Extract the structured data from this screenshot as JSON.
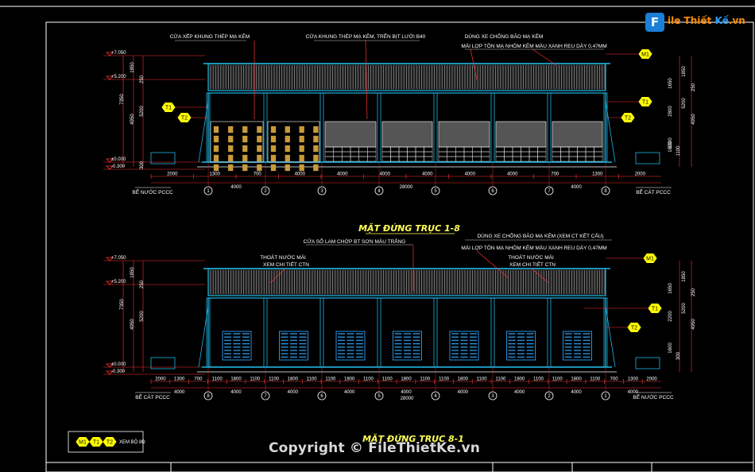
{
  "elev_top": {
    "title": "MẶT ĐỨNG TRỤC 1-8",
    "notes": [
      "CỬA XẾP KHUNG THÉP MẠ KẼM",
      "CỬA KHUNG THÉP MẠ KẼM, TRÊN BỊT LƯỚI B40",
      "DÙNG XE CHỐNG BÃO MẠ KẼM",
      "MÁI LỢP TÔN MẠ NHÔM KẼM MÀU XANH REU DÀY 0,47MM"
    ],
    "levels": [
      "+7.050",
      "+5.200",
      "±0.000",
      "-0.300"
    ],
    "tags": [
      "T1",
      "T2",
      "M1",
      "T1",
      "T2"
    ],
    "dims_row1": [
      "2000",
      "1300",
      "700",
      "4000",
      "4000",
      "4000",
      "4000",
      "4000",
      "4000",
      "700",
      "1300",
      "2000"
    ],
    "dims_row2": [
      "4000",
      "28000",
      "4000"
    ],
    "axes": [
      "1",
      "2",
      "3",
      "4",
      "5",
      "6",
      "7",
      "8"
    ],
    "labels": [
      "BỂ NƯỚC PCCC",
      "BỂ CÁT PCCC"
    ],
    "vert_dims": [
      "1850",
      "250",
      "5200",
      "4950",
      "7350",
      "1650",
      "2800",
      "3300",
      "1100",
      "1600",
      "300"
    ]
  },
  "elev_bottom": {
    "title": "MẶT ĐỨNG TRỤC 8-1",
    "notes": [
      "CỬA SỔ LAM CHỚP BT SƠN MÀU TRẮNG",
      "THOÁT NƯỚC MÁI",
      "XEM CHI TIẾT CTN",
      "DÙNG XE CHỐNG BÃO MẠ KẼM (XEM CT KẾT CẤU)",
      "MÁI LỢP TÔN MẠ NHÔM KẼM MÀU XANH REU DÀY 0,47MM",
      "THOÁT NƯỚC MÁI",
      "XEM CHI TIẾT CTN"
    ],
    "levels": [
      "+7.050",
      "+5.200",
      "±0.000",
      "-0.300"
    ],
    "tags": [
      "M1",
      "T1",
      "T2"
    ],
    "dims_row1": [
      "2000",
      "1300",
      "700",
      "1100",
      "1800",
      "1100",
      "1100",
      "1800",
      "1100",
      "1100",
      "1800",
      "1100",
      "1100",
      "1800",
      "1100",
      "1100",
      "1800",
      "1100",
      "1100",
      "1800",
      "1100",
      "1100",
      "1800",
      "1100",
      "700",
      "1300",
      "2000"
    ],
    "dims_row2": [
      "4000",
      "4000",
      "4000",
      "4000",
      "4000",
      "4000",
      "4000",
      "4000",
      "4000"
    ],
    "dims_row3": [
      "28000"
    ],
    "axes": [
      "8",
      "7",
      "6",
      "5",
      "4",
      "3",
      "2",
      "1"
    ],
    "labels": [
      "BỂ CÁT PCCC",
      "BỂ NƯỚC PCCC"
    ],
    "vert_dims": [
      "1850",
      "250",
      "5200",
      "4950",
      "7350",
      "1650",
      "2200",
      "1600",
      "300"
    ]
  },
  "legend": {
    "tags": [
      "M1",
      "T1",
      "T2"
    ],
    "text": "XEM BỘ 8Đ"
  },
  "watermark": "Copyright © FileThietKe.vn",
  "logo": {
    "f": "F",
    "text_a": "ile Thiết",
    "text_b": " Kế",
    "text_c": ".vn"
  },
  "colors": {
    "background": "#000000",
    "frame": "#ffffff",
    "structure": "#1fb7e6",
    "dimension": "#ff3333",
    "accent_yellow": "#ffff33",
    "door_brown": "#c89a3a",
    "window_blue": "#2a8fd8"
  }
}
